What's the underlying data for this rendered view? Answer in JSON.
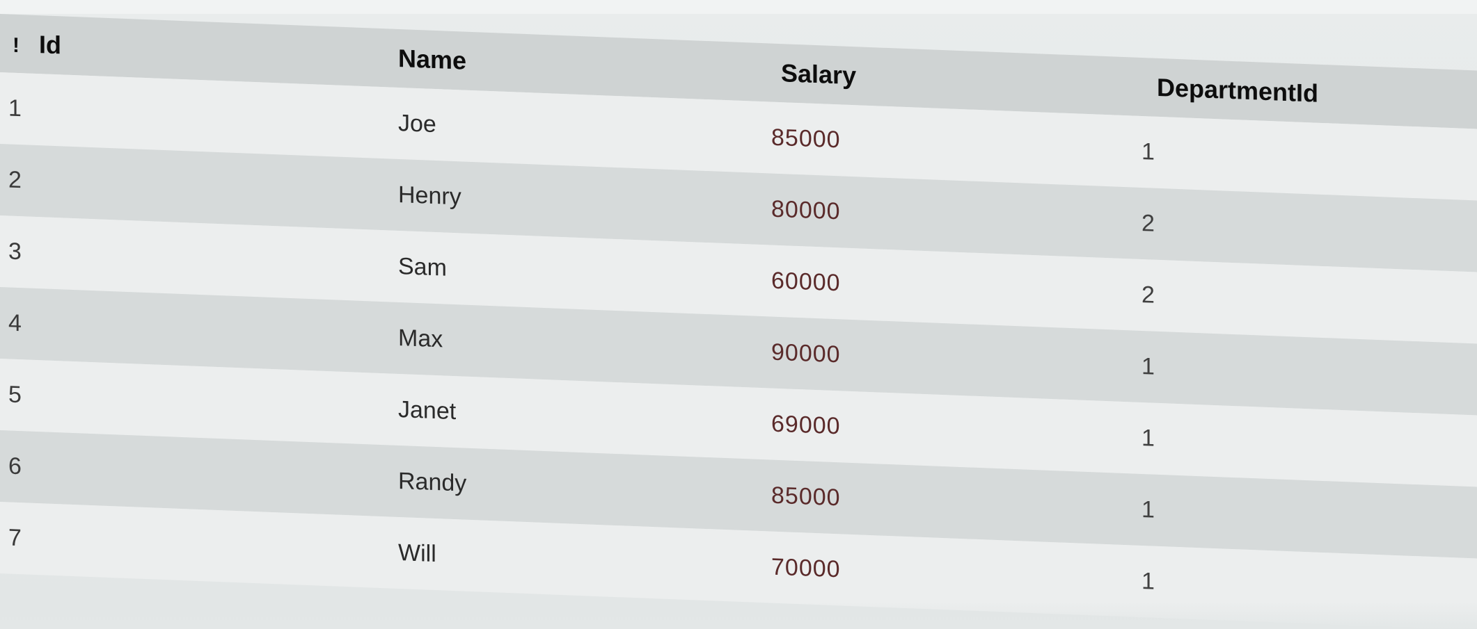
{
  "table": {
    "pin_glyph": "!",
    "columns": [
      {
        "key": "id",
        "label": "Id"
      },
      {
        "key": "name",
        "label": "Name"
      },
      {
        "key": "salary",
        "label": "Salary"
      },
      {
        "key": "department_id",
        "label": "DepartmentId"
      }
    ],
    "rows": [
      {
        "id": "1",
        "name": "Joe",
        "salary": "85000",
        "department_id": "1"
      },
      {
        "id": "2",
        "name": "Henry",
        "salary": "80000",
        "department_id": "2"
      },
      {
        "id": "3",
        "name": "Sam",
        "salary": "60000",
        "department_id": "2"
      },
      {
        "id": "4",
        "name": "Max",
        "salary": "90000",
        "department_id": "1"
      },
      {
        "id": "5",
        "name": "Janet",
        "salary": "69000",
        "department_id": "1"
      },
      {
        "id": "6",
        "name": "Randy",
        "salary": "85000",
        "department_id": "1"
      },
      {
        "id": "7",
        "name": "Will",
        "salary": "70000",
        "department_id": "1"
      }
    ]
  }
}
